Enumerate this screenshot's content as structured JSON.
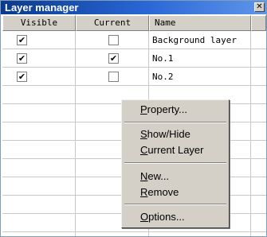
{
  "window": {
    "title": "Layer manager",
    "close_label": "✕"
  },
  "columns": [
    "Visible",
    "Current",
    "Name"
  ],
  "rows": [
    {
      "visible": true,
      "current": false,
      "name": "Background layer"
    },
    {
      "visible": true,
      "current": true,
      "name": "No.1"
    },
    {
      "visible": true,
      "current": false,
      "name": "No.2"
    }
  ],
  "check_mark": "✔",
  "context_menu": {
    "items": [
      "Property...",
      "Show/Hide",
      "Current Layer",
      "New...",
      "Remove",
      "Options..."
    ]
  }
}
